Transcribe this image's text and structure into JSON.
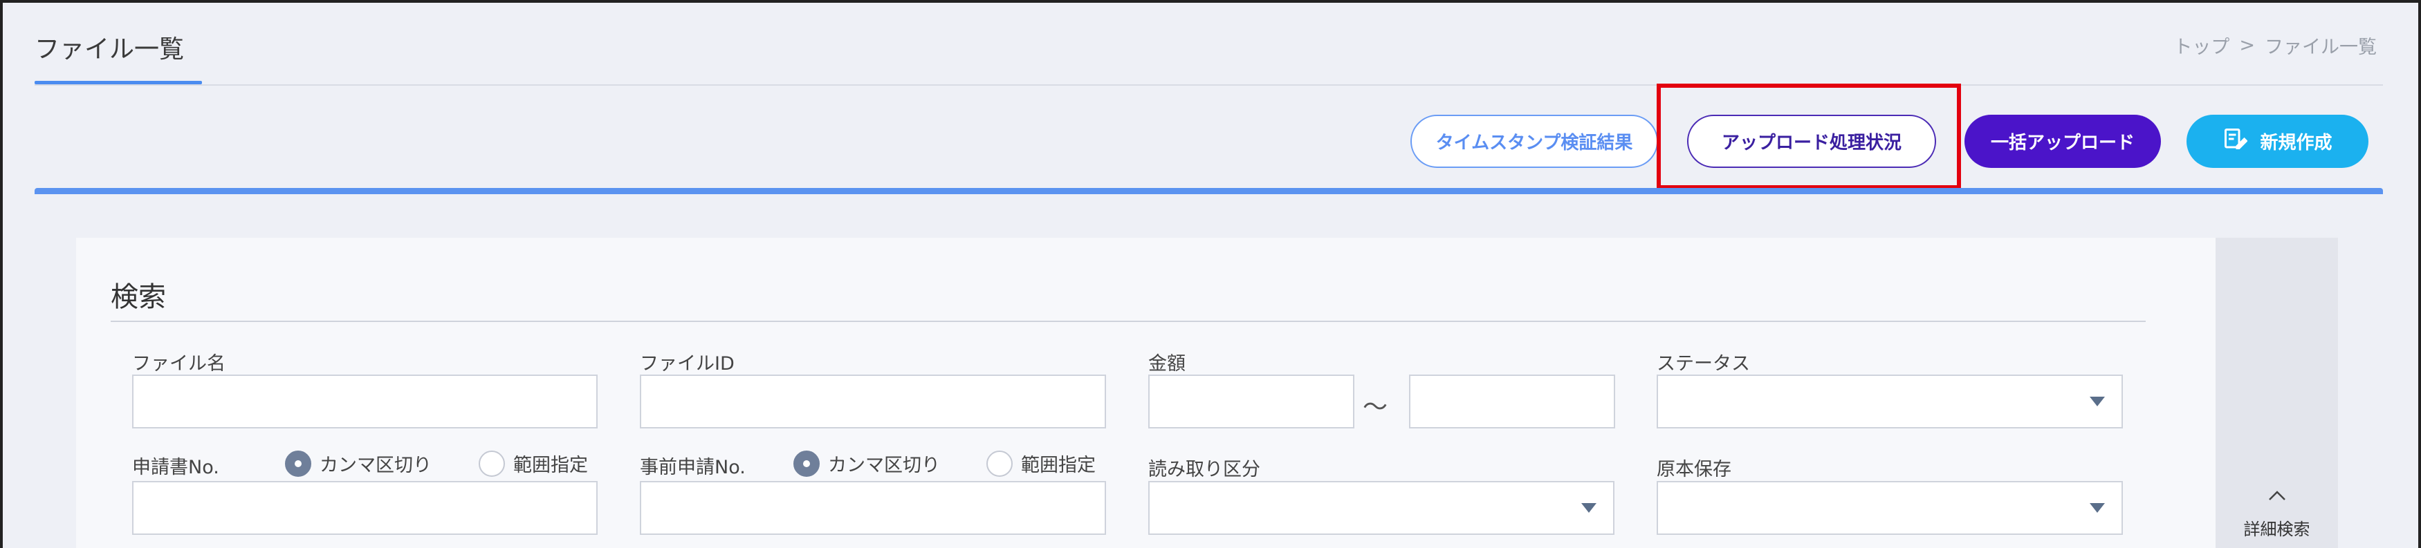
{
  "header": {
    "title": "ファイル一覧",
    "breadcrumb": {
      "home": "トップ",
      "separator": ">",
      "current": "ファイル一覧"
    }
  },
  "actions": {
    "timestamp_result": "タイムスタンプ検証結果",
    "upload_status": "アップロード処理状況",
    "bulk_upload": "一括アップロード",
    "new_create": "新規作成"
  },
  "search": {
    "heading": "検索",
    "file_name_label": "ファイル名",
    "file_id_label": "ファイルID",
    "amount_label": "金額",
    "amount_separator": "～",
    "status_label": "ステータス",
    "application_no_label": "申請書No.",
    "pre_application_no_label": "事前申請No.",
    "radio_comma": "カンマ区切り",
    "radio_range": "範囲指定",
    "read_category_label": "読み取り区分",
    "original_storage_label": "原本保存",
    "detail_search": "詳細検索"
  },
  "colors": {
    "accent_blue": "#4a8cf0",
    "purple": "#4b14c9",
    "cyan": "#1bb1ef",
    "highlight_red": "#e3000f"
  }
}
